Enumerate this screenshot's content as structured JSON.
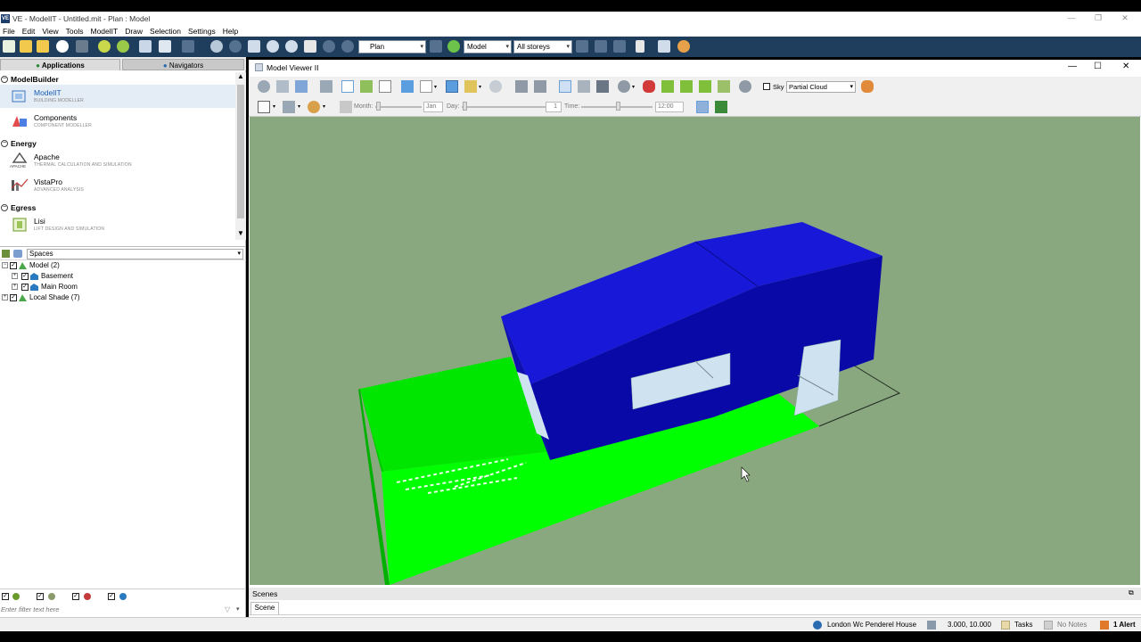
{
  "window": {
    "app_icon": "VE",
    "title": "VE - ModelIT - Untitled.mit - Plan : Model",
    "controls": [
      "—",
      "❐",
      "✕"
    ]
  },
  "menu": [
    "File",
    "Edit",
    "View",
    "Tools",
    "ModelIT",
    "Draw",
    "Selection",
    "Settings",
    "Help"
  ],
  "toolbar": {
    "view_select": "Plan",
    "mode_select": "Model",
    "storey_select": "All storeys"
  },
  "left_panel": {
    "tabs": [
      "Applications",
      "Navigators"
    ],
    "categories": [
      {
        "name": "ModelBuilder",
        "apps": [
          {
            "name": "ModelIT",
            "sub": "BUILDING MODELLER"
          },
          {
            "name": "Components",
            "sub": "COMPONENT MODELLER"
          }
        ]
      },
      {
        "name": "Energy",
        "apps": [
          {
            "name": "Apache",
            "sub": "THERMAL CALCULATION AND SIMULATION",
            "icon_caption": "APACHE"
          },
          {
            "name": "VistaPro",
            "sub": "ADVANCED ANALYSIS"
          }
        ]
      },
      {
        "name": "Egress",
        "apps": [
          {
            "name": "Lisi",
            "sub": "LIFT DESIGN AND SIMULATION"
          }
        ]
      }
    ],
    "spaces_select": "Spaces",
    "tree": [
      {
        "label": "Model (2)",
        "level": 0
      },
      {
        "label": "Basement",
        "level": 1
      },
      {
        "label": "Main Room",
        "level": 1
      },
      {
        "label": "Local Shade (7)",
        "level": 0
      }
    ],
    "filter_placeholder": "Enter filter text here"
  },
  "viewer": {
    "title": "Model Viewer II",
    "sky_label": "Sky",
    "sky_select": "Partial Cloud",
    "month_label": "Month:",
    "month_value": "Jan",
    "day_label": "Day:",
    "day_value": "1",
    "time_label": "Time:",
    "time_value": "12:00",
    "scenes_label": "Scenes",
    "scene_tab": "Scene"
  },
  "status": {
    "location": "London Wc Penderel House",
    "coords": "3.000, 10.000",
    "tasks": "Tasks",
    "notes": "No Notes",
    "alerts": "1 Alert"
  },
  "colors": {
    "toolbar_bg": "#1f3d5c",
    "canvas_bg": "#8aa87f",
    "building_blue": "#1515c8",
    "shade_green": "#00ff00"
  }
}
